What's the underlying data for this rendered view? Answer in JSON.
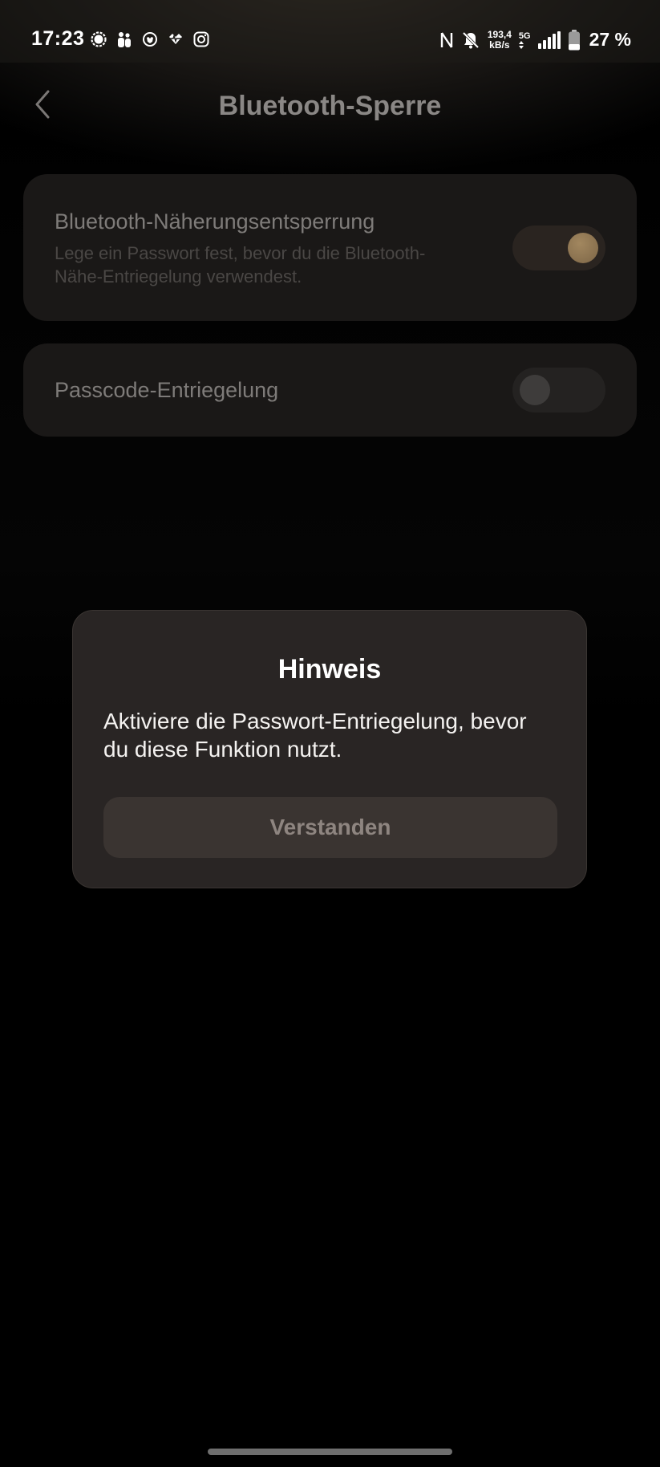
{
  "status_bar": {
    "time": "17:23",
    "left_icons": [
      "signal-messenger-icon",
      "family-icon",
      "lion-app-icon",
      "heart-rate-icon",
      "instagram-icon"
    ],
    "right_icons": [
      "nfc-icon",
      "mute-bell-icon"
    ],
    "data_rate_value": "193,4",
    "data_rate_unit": "kB/s",
    "network": "5G",
    "battery_percent": "27 %"
  },
  "app_bar": {
    "title": "Bluetooth-Sperre",
    "back_icon": "chevron-left-icon"
  },
  "settings": {
    "items": [
      {
        "title": "Bluetooth-Näherungsentsperrung",
        "subtitle": "Lege ein Passwort fest, bevor du die Bluetooth-Nähe-Entriegelung verwendest.",
        "toggle_on": true
      },
      {
        "title": "Passcode-Entriegelung",
        "toggle_on": false
      }
    ]
  },
  "dialog": {
    "title": "Hinweis",
    "message": "Aktiviere die Passwort-Entriegelung, bevor du diese Funktion nutzt.",
    "button_label": "Verstanden"
  },
  "colors": {
    "toggle_on_knob": "#9a7f58",
    "dialog_bg": "#292524",
    "card_bg": "#1a1817"
  }
}
